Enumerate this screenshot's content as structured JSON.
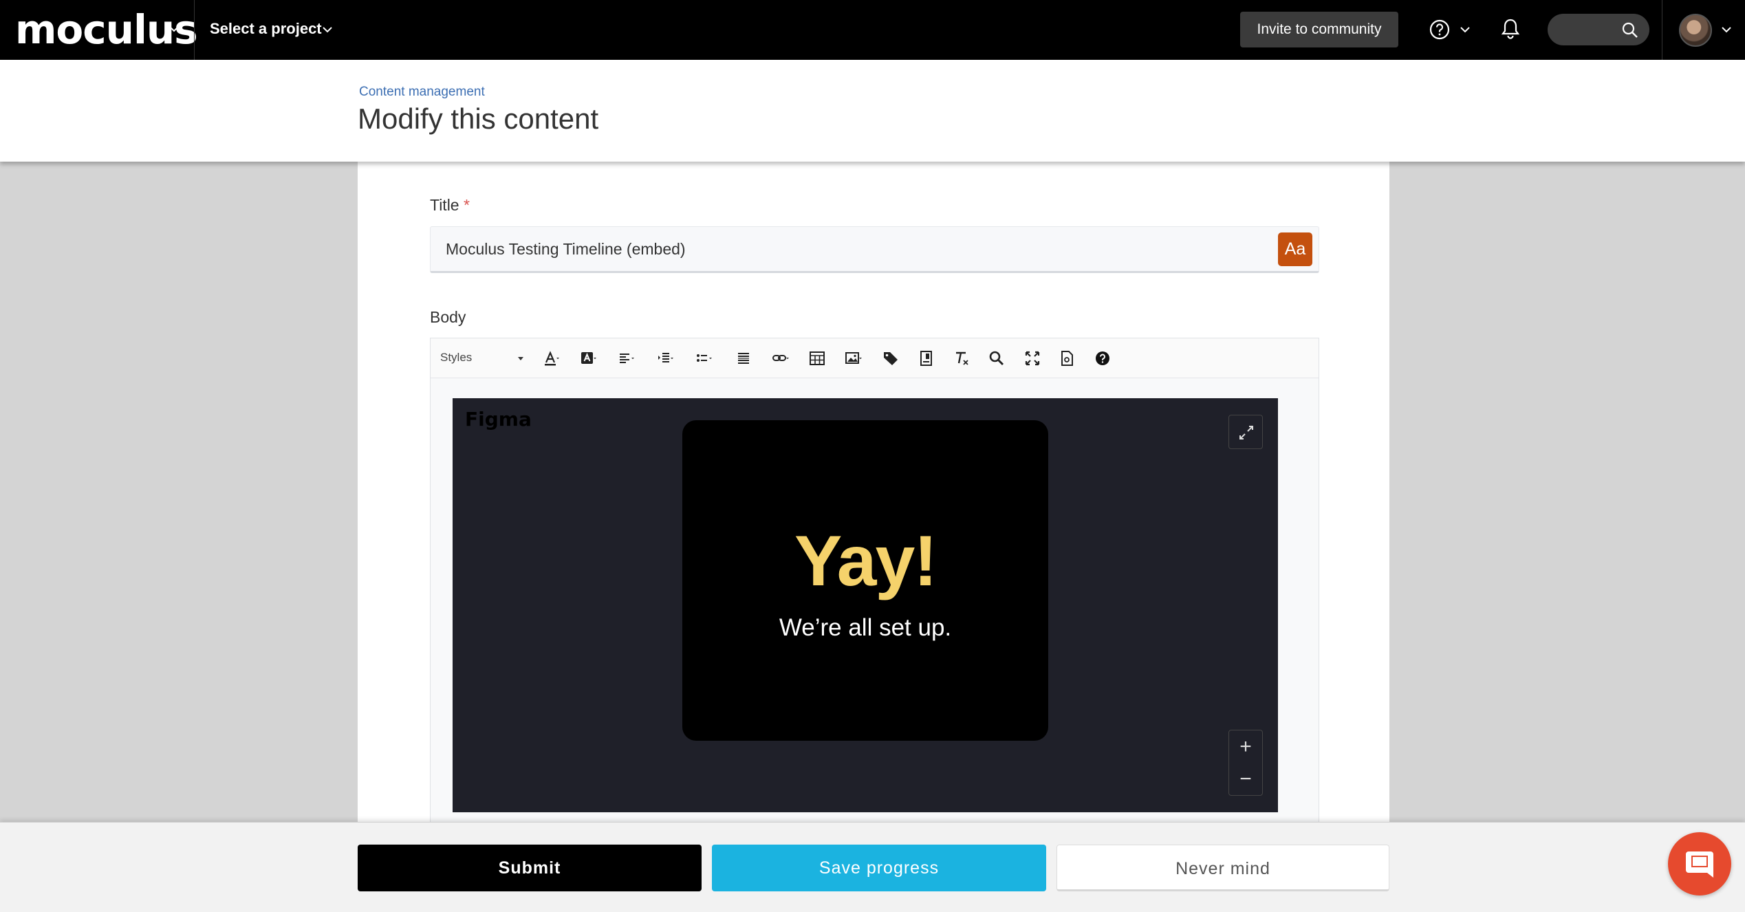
{
  "nav": {
    "logo": "moculus",
    "project_select": "Select a project",
    "invite_label": "Invite to community"
  },
  "header": {
    "breadcrumb": "Content management",
    "title": "Modify this content"
  },
  "form": {
    "title_label": "Title",
    "required_mark": "*",
    "title_value": "Moculus Testing Timeline (embed)",
    "aa_label": "Aa",
    "body_label": "Body"
  },
  "editor": {
    "styles_label": "Styles",
    "embed": {
      "source_label": "Figma",
      "heading": "Yay!",
      "subtext": "We’re all set up.",
      "zoom_in": "+",
      "zoom_out": "−"
    }
  },
  "actions": {
    "submit": "Submit",
    "save": "Save progress",
    "cancel": "Never mind"
  },
  "colors": {
    "accent_blue": "#1bb3e0",
    "aa_orange": "#c4500e",
    "chat_red": "#e64a2e",
    "yay_yellow": "#f5d26b"
  }
}
